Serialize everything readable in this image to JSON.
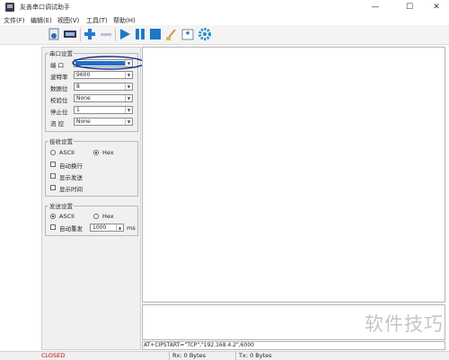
{
  "window": {
    "title": "友善串口调试助手",
    "minimize_glyph": "—",
    "maximize_glyph": "☐",
    "close_glyph": "✕"
  },
  "menu": [
    "文件(F)",
    "编辑(E)",
    "视图(V)",
    "工具(T)",
    "帮助(H)"
  ],
  "toolbar": {
    "icons": [
      "open-file-icon",
      "serial-port-icon",
      "add-icon",
      "remove-icon",
      "play-icon",
      "pause-icon",
      "stop-icon",
      "clear-brush-icon",
      "new-window-icon",
      "settings-gear-icon"
    ]
  },
  "serial_settings": {
    "title": "串口设置",
    "port_label": "端  口",
    "port_value": "",
    "baud_label": "波特率",
    "baud_value": "9600",
    "databits_label": "数据位",
    "databits_value": "8",
    "parity_label": "校验位",
    "parity_value": "None",
    "stopbits_label": "停止位",
    "stopbits_value": "1",
    "flow_label": "流  控",
    "flow_value": "None"
  },
  "receive_settings": {
    "title": "接收设置",
    "ascii_label": "ASCII",
    "hex_label": "Hex",
    "selected": "Hex",
    "auto_wrap_label": "自动换行",
    "show_send_label": "显示发送",
    "show_time_label": "显示时间"
  },
  "send_settings": {
    "title": "发送设置",
    "ascii_label": "ASCII",
    "hex_label": "Hex",
    "selected": "ASCII",
    "auto_resend_label": "自动重发",
    "interval_value": "1000",
    "interval_unit": "ms"
  },
  "send_input": {
    "value": "AT+CIPSTART=\"TCP\",\"192.168.4.2\",6000"
  },
  "status": {
    "state": "CLOSED",
    "rx": "Rx: 0 Bytes",
    "tx": "Tx: 0 Bytes"
  },
  "watermark": "软件技巧",
  "colors": {
    "closed_status": "#cc0000",
    "selection_highlight": "#1e6fc8",
    "annotation_circle": "#1a2f8a",
    "play_blue": "#1e78c8"
  }
}
